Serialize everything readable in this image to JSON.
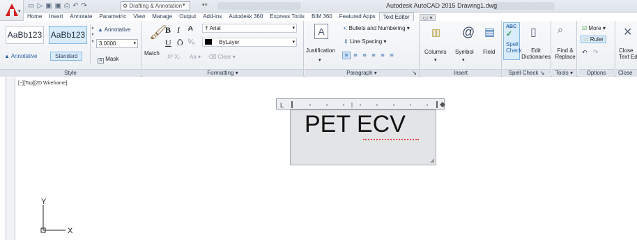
{
  "titlebar": {
    "workspace": "Drafting & Annotation",
    "title": "Autodesk AutoCAD 2015   Drawing1.dwg"
  },
  "tabs": [
    "Home",
    "Insert",
    "Annotate",
    "Parametric",
    "View",
    "Manage",
    "Output",
    "Add-ins",
    "Autodesk 360",
    "Express Tools",
    "BIM 360",
    "Featured Apps",
    "Text Editor"
  ],
  "ribbon": {
    "style": {
      "samples": [
        "AaBb123",
        "AaBb123"
      ],
      "sample_names": [
        "Annotative",
        "Standard"
      ],
      "annotative": "Annotative",
      "height": "3.0000",
      "mask": "Mask",
      "title": "Style"
    },
    "formatting": {
      "match": "Match",
      "bold": "B",
      "italic": "I",
      "strike": "A",
      "underline": "U",
      "overline": "Ō",
      "font": "Arial",
      "color": "ByLayer",
      "clear": "Clear",
      "case": "Aa",
      "title": "Formatting"
    },
    "paragraph": {
      "justification": "Justification",
      "bullets": "Bullets and Numbering",
      "line_spacing": "Line Spacing",
      "title": "Paragraph"
    },
    "insert": {
      "columns": "Columns",
      "symbol": "Symbol",
      "field": "Field",
      "title": "Insert"
    },
    "spell": {
      "spell_check": "Spell Check",
      "edit_dictionaries": "Edit Dictionaries",
      "title": "Spell Check"
    },
    "tools": {
      "find_replace": "Find & Replace",
      "title": "Tools"
    },
    "options": {
      "more": "More",
      "ruler": "Ruler",
      "title": "Options"
    },
    "close": {
      "close_text_editor": "Close Text Edi",
      "title": "Close"
    }
  },
  "drawing": {
    "viewport_label": "[−][Top][2D Wireframe]",
    "mtext": "PET ECV",
    "ucs_x": "X",
    "ucs_y": "Y"
  }
}
